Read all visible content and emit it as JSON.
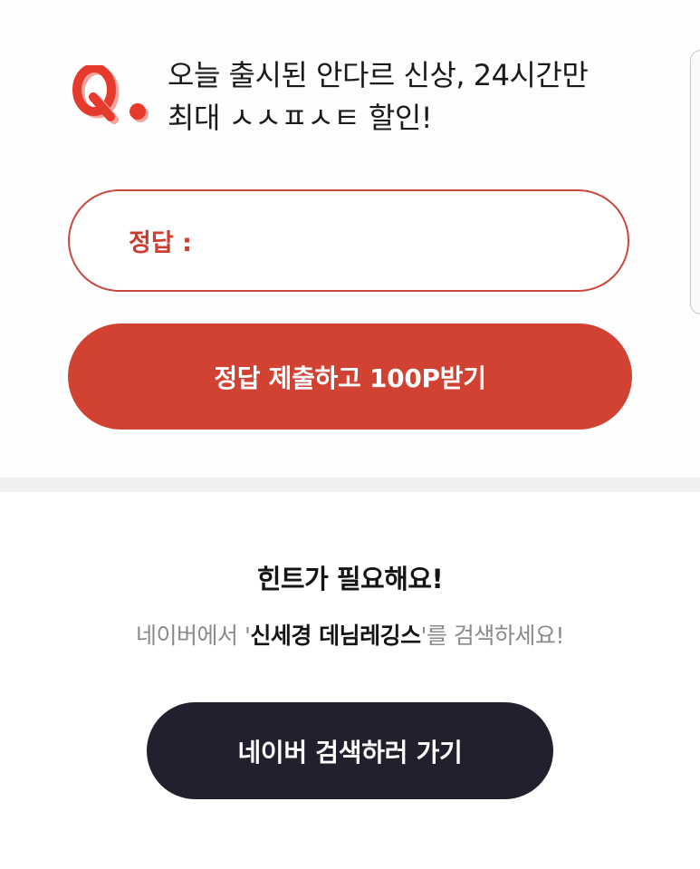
{
  "quiz": {
    "logo_text": "Q.",
    "question_line1": "오늘 출시된 안다르 신상, 24시간만",
    "question_line2": "최대 ㅅㅅㅍㅅㅌ 할인!",
    "answer_label": "정답 :",
    "answer_value": "",
    "submit_label": "정답 제출하고 100P받기",
    "colors": {
      "accent": "#d24233",
      "border": "#c9493d"
    }
  },
  "hint": {
    "title": "힌트가 필요해요!",
    "text_prefix": "네이버에서 '",
    "keyword": "신세경 데님레깅스",
    "text_suffix": "'를 검색하세요!",
    "button_label": "네이버 검색하러 가기",
    "colors": {
      "button_bg": "#21202f"
    }
  }
}
